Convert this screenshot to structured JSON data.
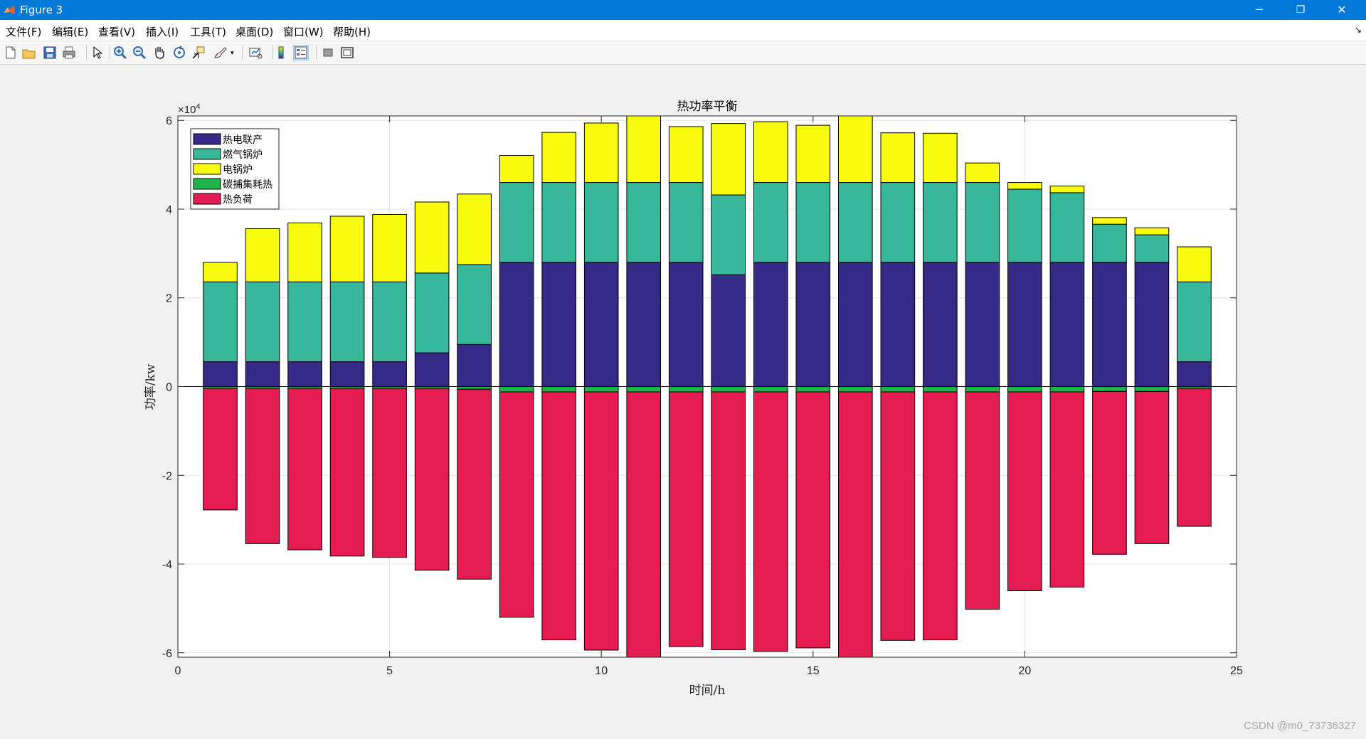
{
  "window": {
    "title": "Figure 3",
    "controls": {
      "minimize": "─",
      "restore": "❐",
      "close": "✕"
    }
  },
  "menu": {
    "items": [
      "文件(F)",
      "编辑(E)",
      "查看(V)",
      "插入(I)",
      "工具(T)",
      "桌面(D)",
      "窗口(W)",
      "帮助(H)"
    ]
  },
  "toolbar": {
    "buttons": [
      {
        "name": "new-figure-icon"
      },
      {
        "name": "open-file-icon"
      },
      {
        "name": "save-icon"
      },
      {
        "name": "print-icon"
      },
      {
        "name": "edit-plot-arrow-icon"
      },
      {
        "name": "zoom-in-icon"
      },
      {
        "name": "zoom-out-icon"
      },
      {
        "name": "pan-hand-icon"
      },
      {
        "name": "rotate-3d-icon"
      },
      {
        "name": "data-cursor-icon"
      },
      {
        "name": "brush-icon"
      },
      {
        "name": "link-plot-icon"
      },
      {
        "name": "colorbar-icon"
      },
      {
        "name": "legend-icon"
      },
      {
        "name": "hide-plot-tools-icon"
      },
      {
        "name": "show-plot-tools-icon"
      }
    ]
  },
  "chart_data": {
    "type": "bar",
    "stacked": true,
    "title": "热功率平衡",
    "xlabel": "时间/h",
    "ylabel": "功率/kw",
    "y_exponent_label": "×10",
    "y_exponent_power": "4",
    "xlim": [
      0,
      25
    ],
    "ylim": [
      -61000,
      61000
    ],
    "xticks": [
      0,
      5,
      10,
      15,
      20,
      25
    ],
    "yticks": [
      -6,
      -4,
      -2,
      0,
      2,
      4,
      6
    ],
    "ytick_scale": 10000,
    "grid": true,
    "legend_position": "top-left",
    "x": [
      1,
      2,
      3,
      4,
      5,
      6,
      7,
      8,
      9,
      10,
      11,
      12,
      13,
      14,
      15,
      16,
      17,
      18,
      19,
      20,
      21,
      22,
      23,
      24
    ],
    "series": [
      {
        "name": "热电联产",
        "color": "#352a87",
        "values": [
          5600,
          5600,
          5600,
          5600,
          5600,
          7600,
          9500,
          28000,
          28000,
          28000,
          28000,
          28000,
          25200,
          28000,
          28000,
          28000,
          28000,
          28000,
          28000,
          28000,
          28000,
          28000,
          28000,
          5600
        ]
      },
      {
        "name": "燃气锅炉",
        "color": "#38b89a",
        "values": [
          18000,
          18000,
          18000,
          18000,
          18000,
          18000,
          18000,
          18000,
          18000,
          18000,
          18000,
          18000,
          18000,
          18000,
          18000,
          18000,
          18000,
          18000,
          18000,
          16500,
          15700,
          8600,
          6200,
          18000
        ]
      },
      {
        "name": "电锅炉",
        "color": "#f9fb0e",
        "values": [
          4400,
          12000,
          13300,
          14800,
          15200,
          16000,
          15900,
          6100,
          11300,
          13400,
          15700,
          12600,
          16100,
          13700,
          12900,
          15400,
          11200,
          11100,
          4400,
          1500,
          1500,
          1500,
          1600,
          7900
        ]
      },
      {
        "name": "碳捕集耗热",
        "color": "#1fb34a",
        "values": [
          -400,
          -400,
          -400,
          -400,
          -400,
          -400,
          -600,
          -1200,
          -1200,
          -1200,
          -1200,
          -1200,
          -1200,
          -1200,
          -1200,
          -1200,
          -1200,
          -1200,
          -1200,
          -1200,
          -1200,
          -1100,
          -1100,
          -400
        ]
      },
      {
        "name": "热负荷",
        "color": "#e51c51",
        "values": [
          -27400,
          -35000,
          -36400,
          -37800,
          -38100,
          -41000,
          -42800,
          -50800,
          -55900,
          -58200,
          -60500,
          -57400,
          -58100,
          -58500,
          -57700,
          -60500,
          -56000,
          -55900,
          -49000,
          -44800,
          -44000,
          -36700,
          -34300,
          -31100
        ]
      }
    ]
  },
  "watermark": "CSDN @m0_73736327"
}
